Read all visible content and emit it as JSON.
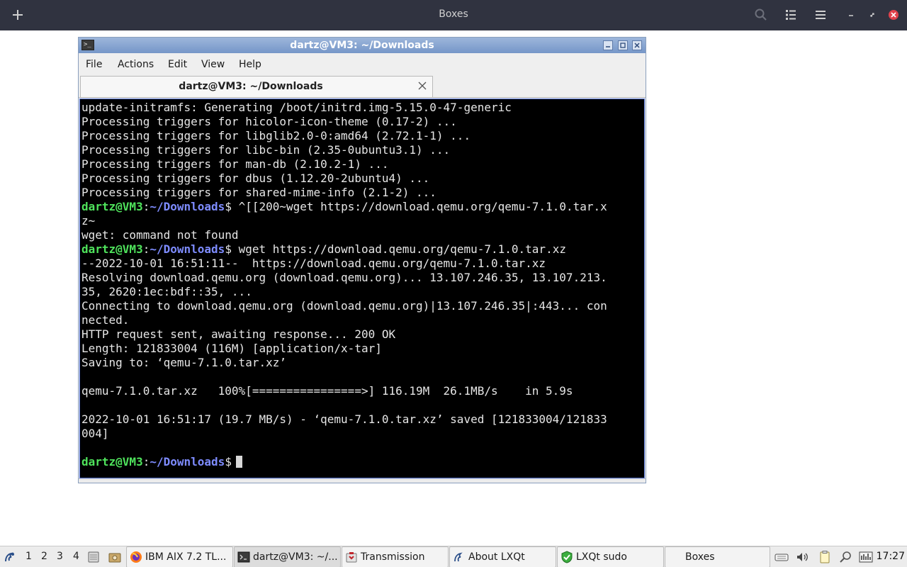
{
  "boxes": {
    "title": "Boxes"
  },
  "window": {
    "title": "dartz@VM3: ~/Downloads",
    "menu": [
      "File",
      "Actions",
      "Edit",
      "View",
      "Help"
    ],
    "tab_label": "dartz@VM3: ~/Downloads"
  },
  "terminal": {
    "prompt_user": "dartz@VM3",
    "prompt_sep": ":",
    "prompt_path": "~/Downloads",
    "prompt_end": "$",
    "lines": [
      "update-initramfs: Generating /boot/initrd.img-5.15.0-47-generic",
      "Processing triggers for hicolor-icon-theme (0.17-2) ...",
      "Processing triggers for libglib2.0-0:amd64 (2.72.1-1) ...",
      "Processing triggers for libc-bin (2.35-0ubuntu3.1) ...",
      "Processing triggers for man-db (2.10.2-1) ...",
      "Processing triggers for dbus (1.12.20-2ubuntu4) ...",
      "Processing triggers for shared-mime-info (2.1-2) ...",
      " ^[[200~wget https://download.qemu.org/qemu-7.1.0.tar.x",
      "z~",
      "wget: command not found",
      " wget https://download.qemu.org/qemu-7.1.0.tar.xz",
      "--2022-10-01 16:51:11--  https://download.qemu.org/qemu-7.1.0.tar.xz",
      "Resolving download.qemu.org (download.qemu.org)... 13.107.246.35, 13.107.213.",
      "35, 2620:1ec:bdf::35, ...",
      "Connecting to download.qemu.org (download.qemu.org)|13.107.246.35|:443... con",
      "nected.",
      "HTTP request sent, awaiting response... 200 OK",
      "Length: 121833004 (116M) [application/x-tar]",
      "Saving to: ‘qemu-7.1.0.tar.xz’",
      "",
      "qemu-7.1.0.tar.xz   100%[================>] 116.19M  26.1MB/s    in 5.9s",
      "",
      "2022-10-01 16:51:17 (19.7 MB/s) - ‘qemu-7.1.0.tar.xz’ saved [121833004/121833",
      "004]",
      "",
      ""
    ]
  },
  "taskbar": {
    "desktops": [
      "1",
      "2",
      "3",
      "4"
    ],
    "tasks": [
      {
        "label": "IBM AIX 7.2 TL..."
      },
      {
        "label": "dartz@VM3: ~/..."
      },
      {
        "label": "Transmission"
      },
      {
        "label": "About LXQt"
      },
      {
        "label": "LXQt sudo"
      },
      {
        "label": "Boxes"
      }
    ],
    "clock": "17:27"
  },
  "colors": {
    "header_bg": "#303340",
    "titlebar": "#7f9ccb",
    "prompt_user": "#4fe35c",
    "prompt_path": "#7e8cff",
    "terminal_bg": "#000000"
  }
}
